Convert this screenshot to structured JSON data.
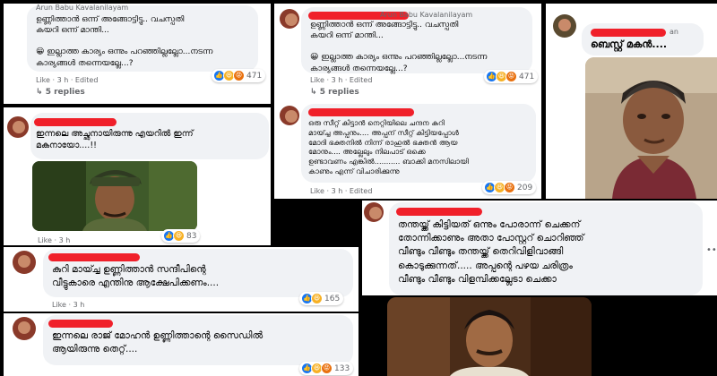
{
  "p1": {
    "name": "Arun Babu Kavalanilayam",
    "text": "ഉണ്ണിത്താൻ ഒന്ന് അങ്ങോട്ടിട്ടു.. വചസ്പതി\nകയറി ഒന്ന് മാന്തി...\n\n😀 ഇല്ലാത്ത കാര്യം ഒന്നും പറഞ്ഞില്ലല്ലോ...നടന്ന\nകാര്യങ്ങൾ തന്നെയല്ലേ...?",
    "meta": "Like · 3 h · Edited",
    "count": "471",
    "replies": "5 replies"
  },
  "p2": {
    "name": "Arun Babu Kavalanilayam",
    "text": "ഉണ്ണിത്താൻ ഒന്ന് അങ്ങോട്ടിട്ടു.. വചസ്പതി\nകയറി ഒന്ന് മാന്തി...\n\n😀 ഇല്ലാത്ത കാര്യം ഒന്നും പറഞ്ഞില്ലല്ലോ...നടന്ന\nകാര്യങ്ങൾ തന്നെയല്ലേ...?",
    "meta": "Like · 3 h · Edited",
    "count": "471",
    "replies": "5 replies"
  },
  "p3": {
    "text": "ഒരു സീറ്റ് കിട്ടാൻ നെറ്റിയിലെ ചന്ദന കുറി\nമായ്ച്ച അപ്പനും.... അപ്പന് സീറ്റ് കിട്ടിയപ്പോൾ\nമോദി ഭക്തനിൽ നിന്ന് രാഹുൽ ഭക്തൻ ആയ\nമോനും.... അല്ലേലും നിലപാട് ഒക്കെ\nഉണ്ടാവണം എങ്കിൽ........... ബാക്കി മനസിലായി\nകാണും എന്ന് വിചാരിക്കുന്നു",
    "meta": "Like · 3 h · Edited",
    "count": "209"
  },
  "p4": {
    "name_suffix": "an",
    "text": "ബെസ്റ്റ് മകൻ...."
  },
  "p5": {
    "text": "ഇന്നലെ അച്ഛനായിരുന്നു എയറിൽ ഇന്ന്\nമകനായോ....!!",
    "meta": "Like · 3 h",
    "count": "83"
  },
  "p6": {
    "text": "തന്തയ്ക്ക് കിട്ടിയത് ഒന്നും പോരാന്ന് ചെക്കന്\nതോന്നിക്കാണും അതാ പോസ്റ്ററ് ചൊറിഞ്ഞ്\nവീണ്ടും വീണ്ടും തന്തയ്ക്ക് തെറിവിളിവാങ്ങി\nകൊടുക്കുന്നത്..... അപ്പന്റെ പഴയ ചരിത്രം\nവീണ്ടും വീണ്ടും വിളമ്പിക്കല്ലേടാ ചെക്കാ"
  },
  "p7": {
    "text": "കുറി മായ്ച്ച ഉണ്ണിത്താൻ സന്ദീപിന്റെ\nവീട്ടുകാരെ എന്തിനു ആക്ഷേപിക്കണം....",
    "meta": "Like · 3 h",
    "count": "165"
  },
  "p8": {
    "text": "ഇന്നലെ രാജ് മോഹൻ ഉണ്ണിത്താന്റെ സൈഡിൽ\nആയിരുന്നു തെറ്റ്....",
    "count": "133"
  }
}
